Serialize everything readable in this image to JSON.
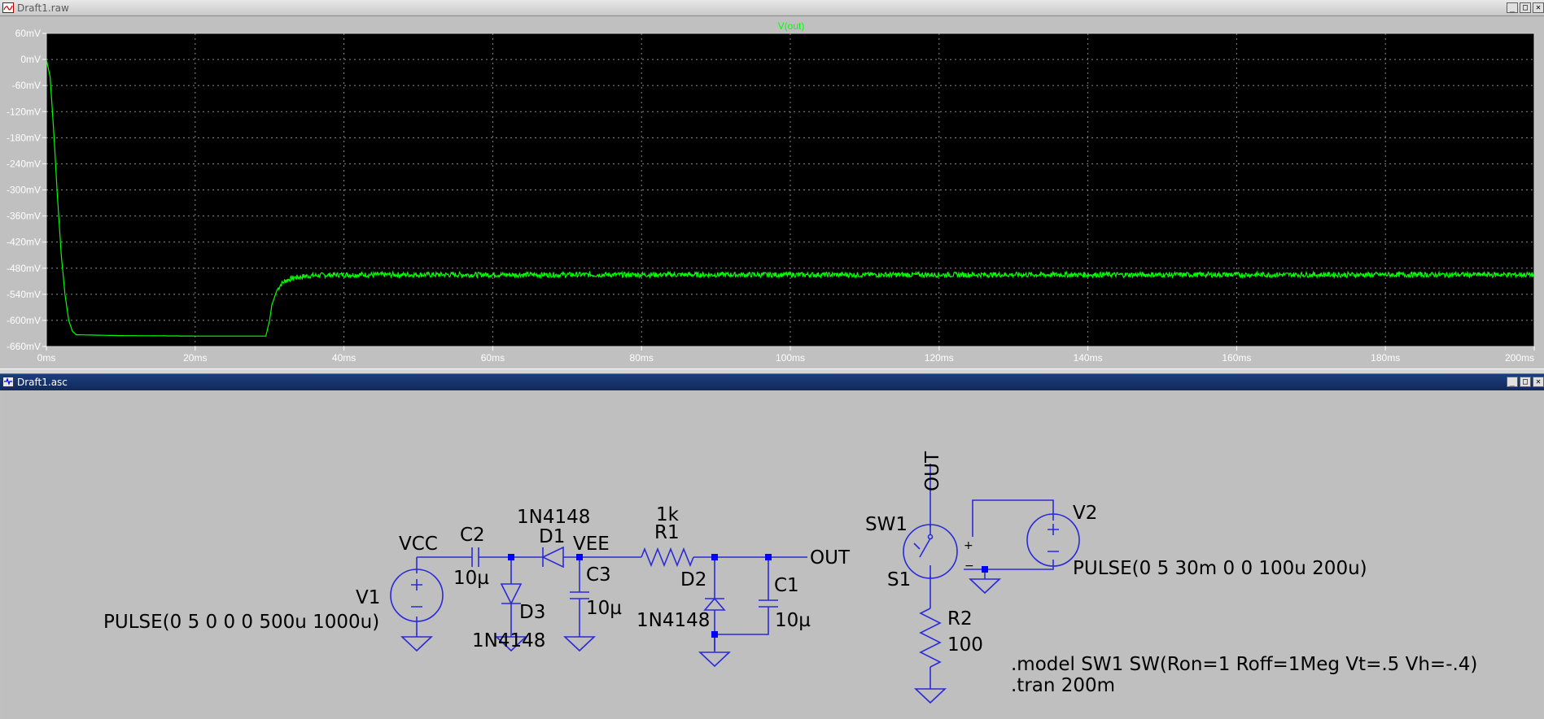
{
  "plot_window": {
    "title": "Draft1.raw",
    "controls": [
      "_",
      "□",
      "✕"
    ]
  },
  "schematic_window": {
    "title": "Draft1.asc",
    "controls": [
      "_",
      "□",
      "✕"
    ]
  },
  "colors": {
    "plot_background": "#000000",
    "trace": "#00ff00",
    "grid": "#888888",
    "axis_text": "#ffffff",
    "schematic_wire": "#2a2ad8",
    "schematic_text": "#000000",
    "junction": "#0000ff"
  },
  "chart_data": {
    "type": "line",
    "title": "V(out)",
    "xlabel": "",
    "ylabel": "",
    "x_unit": "ms",
    "y_unit": "mV",
    "xlim": [
      0,
      200
    ],
    "ylim": [
      -660,
      60
    ],
    "x_ticks": [
      "0ms",
      "20ms",
      "40ms",
      "60ms",
      "80ms",
      "100ms",
      "120ms",
      "140ms",
      "160ms",
      "180ms",
      "200ms"
    ],
    "y_ticks": [
      "60mV",
      "0mV",
      "-60mV",
      "-120mV",
      "-180mV",
      "-240mV",
      "-300mV",
      "-360mV",
      "-420mV",
      "-480mV",
      "-540mV",
      "-600mV",
      "-660mV"
    ],
    "grid": true,
    "series": [
      {
        "name": "V(out)",
        "x": [
          0,
          0.5,
          1,
          1.5,
          2,
          2.5,
          3,
          3.5,
          4,
          10,
          20,
          29.5,
          30,
          30.3,
          30.7,
          31,
          31.5,
          32,
          33,
          34,
          35,
          37,
          40,
          60,
          100,
          150,
          200
        ],
        "y": [
          0,
          -40,
          -170,
          -320,
          -450,
          -540,
          -600,
          -625,
          -633,
          -635,
          -636,
          -636,
          -600,
          -565,
          -545,
          -530,
          -518,
          -510,
          -503,
          -500,
          -498,
          -496,
          -495,
          -495,
          -495,
          -495,
          -495
        ],
        "ripple_mV_peak_to_peak": 12,
        "ripple_start_ms": 30
      }
    ]
  },
  "schematic": {
    "labels": {
      "vcc": "VCC",
      "vee": "VEE",
      "out_net": "OUT",
      "out_vertical": "OUT",
      "v1": "V1",
      "v1_value": "PULSE(0 5 0 0 0 500u 1000u)",
      "c2": "C2",
      "c2_value": "10µ",
      "d1": "D1",
      "d1_model": "1N4148",
      "d3": "D3",
      "d3_model": "1N4148",
      "c3": "C3",
      "c3_value": "10µ",
      "r1": "R1",
      "r1_value": "1k",
      "d2": "D2",
      "d2_model": "1N4148",
      "c1": "C1",
      "c1_value": "10µ",
      "sw1": "SW1",
      "s1": "S1",
      "r2": "R2",
      "r2_value": "100",
      "v2": "V2",
      "v2_value": "PULSE(0 5 30m 0 0 100u 200u)",
      "sw_plus": "+",
      "sw_minus": "−",
      "directive_model": ".model SW1 SW(Ron=1 Roff=1Meg Vt=.5 Vh=-.4)",
      "directive_tran": ".tran 200m"
    }
  }
}
